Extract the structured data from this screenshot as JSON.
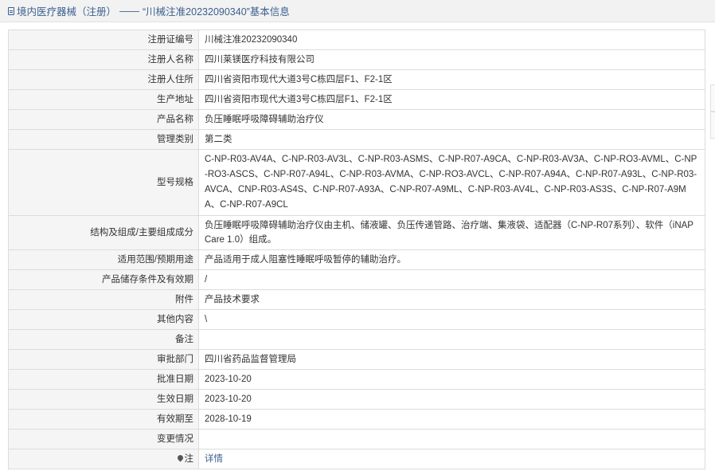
{
  "breadcrumb": {
    "section": "境内医疗器械（注册）",
    "separator": "——",
    "title": "“川械注准20232090340”基本信息"
  },
  "rows": [
    {
      "label": "注册证编号",
      "value": "川械注准20232090340"
    },
    {
      "label": "注册人名称",
      "value": "四川莱镁医疗科技有限公司"
    },
    {
      "label": "注册人住所",
      "value": "四川省资阳市现代大道3号C栋四层F1、F2-1区"
    },
    {
      "label": "生产地址",
      "value": "四川省资阳市现代大道3号C栋四层F1、F2-1区"
    },
    {
      "label": "产品名称",
      "value": "负压睡眠呼吸障碍辅助治疗仪"
    },
    {
      "label": "管理类别",
      "value": "第二类"
    },
    {
      "label": "型号规格",
      "value": "C-NP-R03-AV4A、C-NP-R03-AV3L、C-NP-R03-ASMS、C-NP-R07-A9CA、C-NP-R03-AV3A、C-NP-RO3-AVML、C-NP-RO3-ASCS、C-NP-R07-A94L、C-NP-R03-AVMA、C-NP-RO3-AVCL、C-NP-R07-A94A、C-NP-R07-A93L、C-NP-R03-AVCA、CNP-R03-AS4S、C-NP-R07-A93A、C-NP-R07-A9ML、C-NP-R03-AV4L、C-NP-R03-AS3S、C-NP-R07-A9MA、C-NP-R07-A9CL"
    },
    {
      "label": "结构及组成/主要组成成分",
      "value": "负压睡眠呼吸障碍辅助治疗仪由主机、储液罐、负压传递管路、治疗端、集液袋、适配器（C-NP-R07系列）、软件（iNAP Care 1.0）组成。"
    },
    {
      "label": "适用范围/预期用途",
      "value": "产品适用于成人阻塞性睡眠呼吸暂停的辅助治疗。"
    },
    {
      "label": "产品储存条件及有效期",
      "value": "/"
    },
    {
      "label": "附件",
      "value": "产品技术要求"
    },
    {
      "label": "其他内容",
      "value": "\\"
    },
    {
      "label": "备注",
      "value": ""
    },
    {
      "label": "审批部门",
      "value": "四川省药品监督管理局"
    },
    {
      "label": "批准日期",
      "value": "2023-10-20"
    },
    {
      "label": "生效日期",
      "value": "2023-10-20"
    },
    {
      "label": "有效期至",
      "value": "2028-10-19"
    },
    {
      "label": "变更情况",
      "value": ""
    }
  ],
  "note_row": {
    "label": "注",
    "link_text": "详情",
    "icon": "location-pin-icon"
  },
  "colors": {
    "link": "#3a5f8f",
    "label_bg": "#f5f5f5",
    "border": "#dcdcdc",
    "header_bg": "#f2f2f2"
  }
}
